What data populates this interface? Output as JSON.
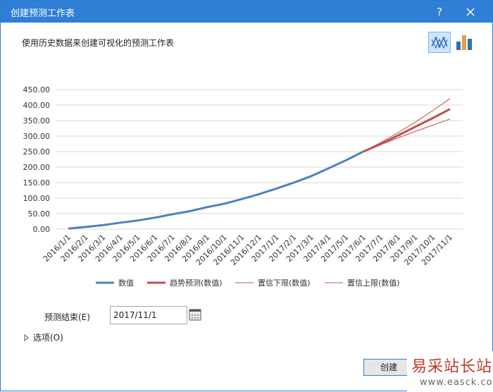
{
  "dialog": {
    "title": "创建预测工作表",
    "help_label": "?",
    "subtitle": "使用历史数据来创建可视化的预测工作表"
  },
  "forecast_end": {
    "label": "预测结束(E)",
    "value": "2017/11/1"
  },
  "options": {
    "label": "选项(O)"
  },
  "create_button": {
    "label": "创建"
  },
  "watermark": {
    "text": "易采站长站",
    "url": "www.easck.com"
  },
  "colors": {
    "value_line": "#4f81bd",
    "trend_line": "#c0504d",
    "bound_line": "#c0504d",
    "titlebar": "#2f7fd6"
  },
  "chart_data": {
    "type": "line",
    "x": [
      "2016/1/1",
      "2016/2/1",
      "2016/3/1",
      "2016/4/1",
      "2016/5/1",
      "2016/6/1",
      "2016/7/1",
      "2016/8/1",
      "2016/9/1",
      "2016/10/1",
      "2016/11/1",
      "2016/12/1",
      "2017/1/1",
      "2017/2/1",
      "2017/3/1",
      "2017/4/1",
      "2017/5/1",
      "2017/6/1",
      "2017/7/1",
      "2017/8/1",
      "2017/9/1",
      "2017/10/1",
      "2017/11/1"
    ],
    "ylim": [
      0,
      450
    ],
    "yticks": [
      "0.00",
      "50.00",
      "100.00",
      "150.00",
      "200.00",
      "250.00",
      "300.00",
      "350.00",
      "400.00",
      "450.00"
    ],
    "grid": true,
    "legend_position": "bottom",
    "series": [
      {
        "name": "数值",
        "values": [
          2,
          7,
          13,
          21,
          28,
          37,
          48,
          58,
          71,
          82,
          97,
          113,
          131,
          150,
          171,
          196,
          222,
          250,
          null,
          null,
          null,
          null,
          null
        ]
      },
      {
        "name": "趋势预测(数值)",
        "values": [
          null,
          null,
          null,
          null,
          null,
          null,
          null,
          null,
          null,
          null,
          null,
          null,
          null,
          null,
          null,
          null,
          null,
          250,
          274,
          302,
          330,
          358,
          387
        ]
      },
      {
        "name": "置信下限(数值)",
        "values": [
          null,
          null,
          null,
          null,
          null,
          null,
          null,
          null,
          null,
          null,
          null,
          null,
          null,
          null,
          null,
          null,
          null,
          250,
          272,
          294,
          315,
          335,
          355
        ]
      },
      {
        "name": "置信上限(数值)",
        "values": [
          null,
          null,
          null,
          null,
          null,
          null,
          null,
          null,
          null,
          null,
          null,
          null,
          null,
          null,
          null,
          null,
          null,
          250,
          279,
          311,
          345,
          382,
          421
        ]
      }
    ]
  }
}
